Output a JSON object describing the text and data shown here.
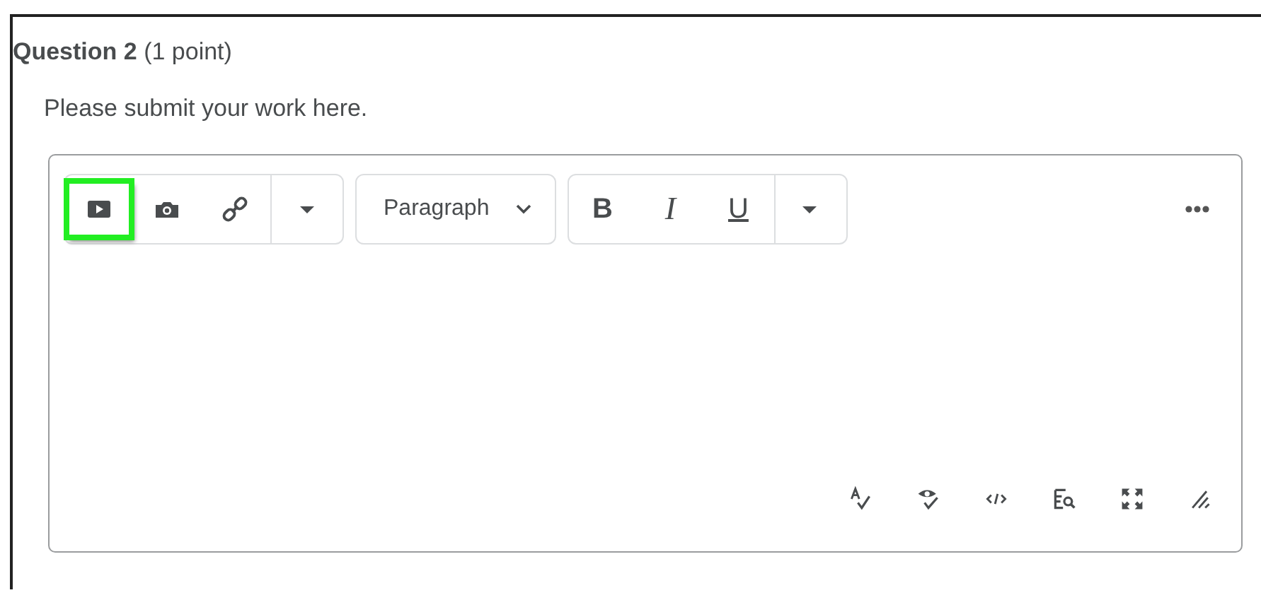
{
  "question": {
    "heading": "**Question 2** (1 point)",
    "prompt": "Please submit your work here."
  },
  "editor": {
    "toolbar": [
      {
        "kind": "group",
        "items": [
          {
            "kind": "video",
            "highlighted": true
          },
          {
            "kind": "camera",
            "highlighted": false
          },
          {
            "kind": "link",
            "highlighted": false
          },
          {
            "kind": "caret",
            "highlighted": false
          }
        ]
      },
      {
        "kind": "select",
        "label": "Paragraph"
      },
      {
        "kind": "group",
        "items": [
          {
            "kind": "bold",
            "label": "B",
            "highlighted": false
          },
          {
            "kind": "italic",
            "label": "I",
            "highlighted": false
          },
          {
            "kind": "underline",
            "label": "U",
            "highlighted": false
          },
          {
            "kind": "caret",
            "highlighted": false
          }
        ]
      }
    ],
    "footer_tools": [
      {
        "kind": "spellcheck"
      },
      {
        "kind": "accessibility"
      },
      {
        "kind": "source"
      },
      {
        "kind": "preview"
      },
      {
        "kind": "fullscreen"
      },
      {
        "kind": "resize"
      }
    ]
  }
}
